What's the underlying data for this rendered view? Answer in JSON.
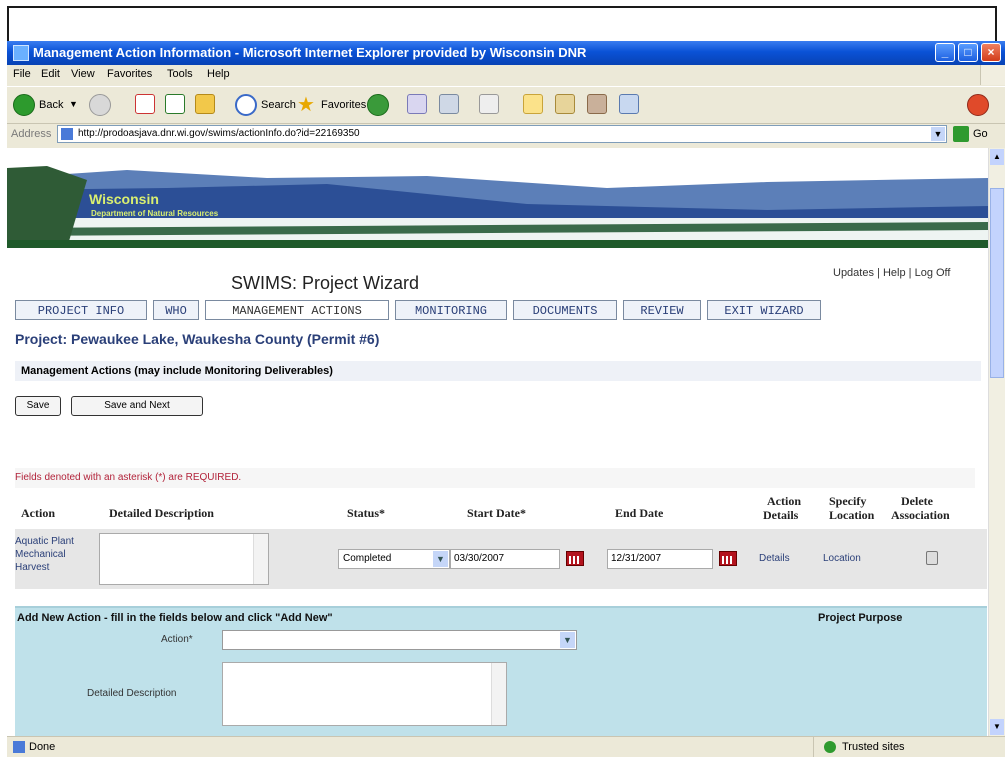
{
  "window": {
    "title": "Management Action Information - Microsoft Internet Explorer provided by Wisconsin DNR",
    "minimize": "_",
    "maximize": "□",
    "close": "×"
  },
  "menu": [
    "File",
    "Edit",
    "View",
    "Favorites",
    "Tools",
    "Help"
  ],
  "toolbar": {
    "back": "Back",
    "search": "Search",
    "favorites": "Favorites"
  },
  "address": {
    "label": "Address",
    "url": "http://prodoasjava.dnr.wi.gov/swims/actionInfo.do?id=22169350",
    "go": "Go"
  },
  "banner": {
    "line1": "Wisconsin",
    "line2": "Department of Natural Resources"
  },
  "page": {
    "title": "SWIMS: Project Wizard",
    "links": [
      "Updates",
      "Help",
      "Log Off"
    ],
    "tabs": [
      "PROJECT INFO",
      "WHO",
      "MANAGEMENT ACTIONS",
      "MONITORING",
      "DOCUMENTS",
      "REVIEW",
      "EXIT WIZARD"
    ],
    "active_tab": "MANAGEMENT ACTIONS",
    "project": "Project: Pewaukee Lake, Waukesha County (Permit #6)",
    "section": "Management Actions (may include Monitoring Deliverables)",
    "save_label": "Save",
    "save_next_label": "Save and Next",
    "required_note": "Fields denoted with an asterisk (*) are REQUIRED."
  },
  "table": {
    "headers": {
      "action": "Action",
      "description": "Detailed Description",
      "status": "Status*",
      "start": "Start Date*",
      "end": "End Date",
      "details1": "Action",
      "details2": "Details",
      "location1": "Specify",
      "location2": "Location",
      "delete1": "Delete",
      "delete2": "Association"
    },
    "rows": [
      {
        "action": "Aquatic Plant Mechanical Harvest",
        "status": "Completed",
        "start": "03/30/2007",
        "end": "12/31/2007",
        "details": "Details",
        "location": "Location"
      }
    ]
  },
  "add_new": {
    "header": "Add New Action - fill in the fields below and click \"Add New\"",
    "project_purpose": "Project Purpose",
    "action_label": "Action*",
    "description_label": "Detailed Description"
  },
  "status": {
    "text": "Done",
    "zone": "Trusted sites"
  }
}
